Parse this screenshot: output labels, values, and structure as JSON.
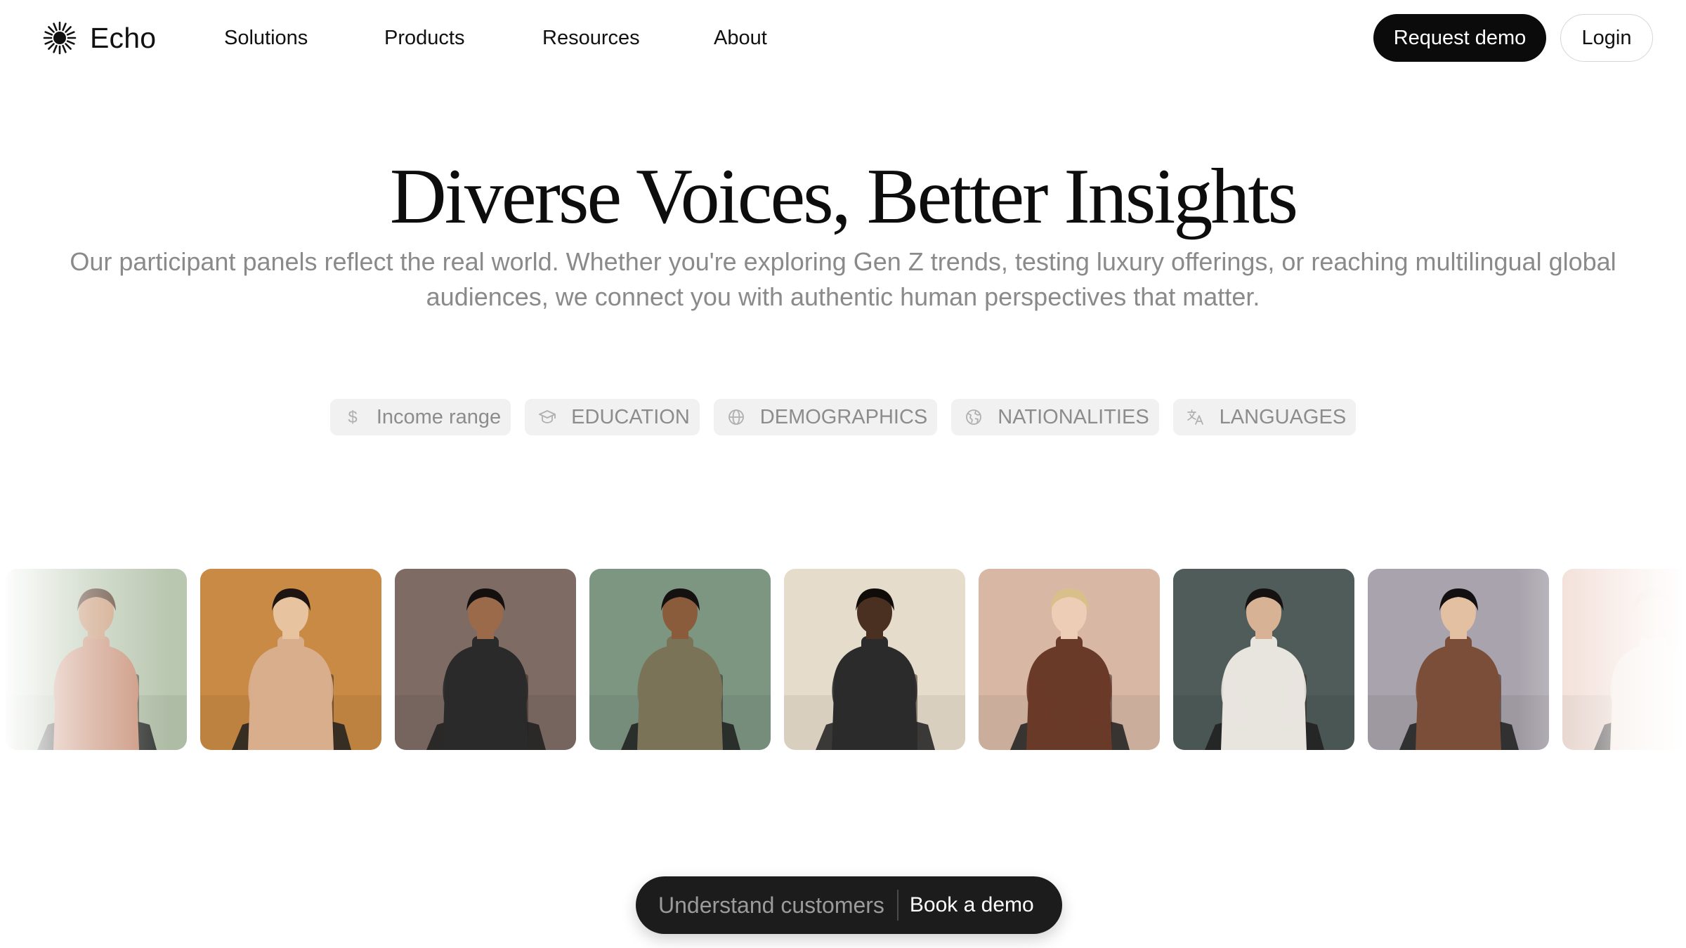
{
  "brand": {
    "name": "Echo",
    "logo_icon": "sunburst-icon"
  },
  "nav": {
    "items": [
      {
        "label": "Solutions"
      },
      {
        "label": "Products"
      },
      {
        "label": "Resources"
      },
      {
        "label": "About"
      }
    ],
    "request_demo_label": "Request demo",
    "login_label": "Login"
  },
  "hero": {
    "title": "Diverse Voices, Better Insights",
    "subtitle": "Our participant panels reflect the real world. Whether you're exploring Gen Z trends, testing luxury offerings, or reaching multilingual global audiences, we connect you with authentic human perspectives that matter."
  },
  "filters": [
    {
      "label": "Income range",
      "icon": "dollar-icon"
    },
    {
      "label": "EDUCATION",
      "icon": "graduation-cap-icon"
    },
    {
      "label": "DEMOGRAPHICS",
      "icon": "globe-icon"
    },
    {
      "label": "NATIONALITIES",
      "icon": "earth-icon"
    },
    {
      "label": "LANGUAGES",
      "icon": "translate-icon"
    }
  ],
  "carousel": {
    "portraits": [
      {
        "bg": "#b9c7b0",
        "sweater": "#c9927a",
        "skin": "#c99a78",
        "hair": "#5a4030"
      },
      {
        "bg": "#c98a45",
        "sweater": "#d8ae8c",
        "skin": "#e8c3a0",
        "hair": "#1e1512"
      },
      {
        "bg": "#7e6c64",
        "sweater": "#2a2a2a",
        "skin": "#9a6a4a",
        "hair": "#141010"
      },
      {
        "bg": "#7d9682",
        "sweater": "#7a7358",
        "skin": "#8a5c3c",
        "hair": "#151111"
      },
      {
        "bg": "#e6dccb",
        "sweater": "#2b2b2b",
        "skin": "#4a3020",
        "hair": "#0f0c0a"
      },
      {
        "bg": "#d8b8a5",
        "sweater": "#6a3a28",
        "skin": "#edcdb5",
        "hair": "#d9c08a"
      },
      {
        "bg": "#4f5c59",
        "sweater": "#e8e4de",
        "skin": "#d8b294",
        "hair": "#161212"
      },
      {
        "bg": "#a8a3ac",
        "sweater": "#7a4e38",
        "skin": "#e3c0a2",
        "hair": "#121010"
      },
      {
        "bg": "#efd6cd",
        "sweater": "#f3e6dc",
        "skin": "#f0d8c8",
        "hair": "#e8d0c0"
      }
    ]
  },
  "cta": {
    "text": "Understand customers",
    "button_label": "Book a demo"
  }
}
